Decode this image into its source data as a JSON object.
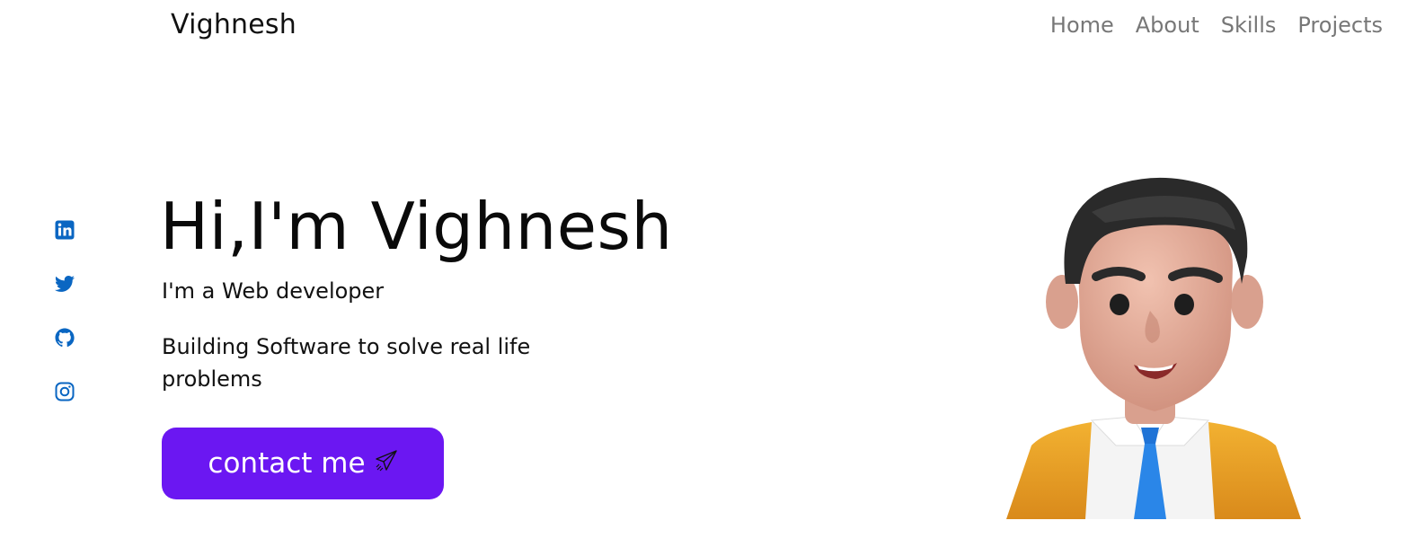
{
  "header": {
    "brand": "Vighnesh",
    "nav": [
      {
        "label": "Home"
      },
      {
        "label": "About"
      },
      {
        "label": "Skills"
      },
      {
        "label": "Projects"
      }
    ]
  },
  "social": [
    {
      "icon": "linkedin-icon"
    },
    {
      "icon": "twitter-icon"
    },
    {
      "icon": "github-icon"
    },
    {
      "icon": "instagram-icon"
    }
  ],
  "hero": {
    "title": "Hi,I'm Vighnesh",
    "subtitle": "I'm a Web developer",
    "tagline": "Building Software to solve real life problems",
    "cta_label": "contact me",
    "cta_icon": "paper-plane-icon"
  },
  "colors": {
    "accent": "#6b17f2",
    "social_icon": "#0a66c2",
    "nav_text": "#777777"
  }
}
